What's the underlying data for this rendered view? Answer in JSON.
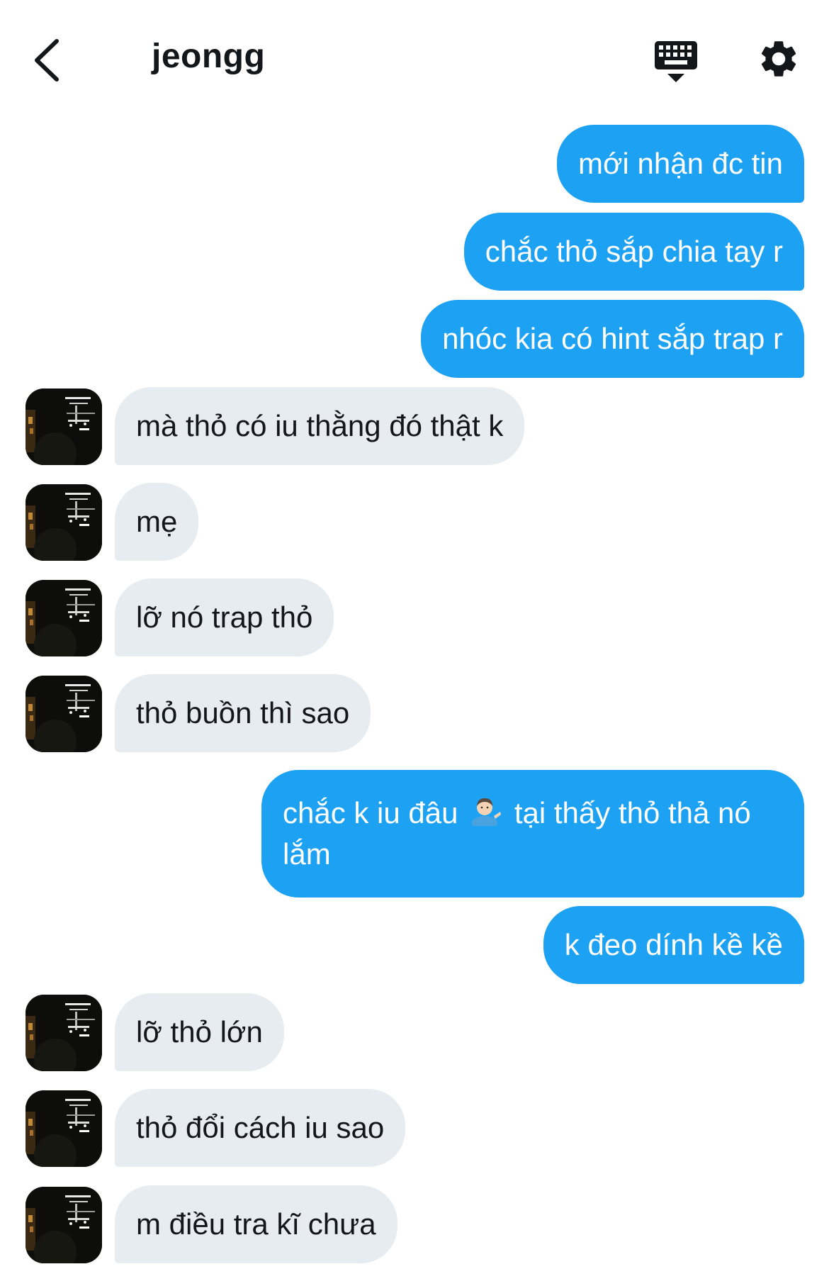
{
  "header": {
    "title": "jeongg",
    "back_icon": "chevron-left-icon",
    "keyboard_icon": "keyboard-dismiss-icon",
    "settings_icon": "gear-icon"
  },
  "colors": {
    "outgoing_bubble": "#1da1f2",
    "incoming_bubble": "#e6ecf0",
    "text_dark": "#14171a"
  },
  "messages": [
    {
      "sender": "me",
      "text": "mới nhận đc tin"
    },
    {
      "sender": "me",
      "text": "chắc thỏ sắp chia tay r"
    },
    {
      "sender": "me",
      "text": "nhóc kia có hint sắp trap r"
    },
    {
      "sender": "jeongg",
      "text": "mà thỏ có iu thằng đó thật k"
    },
    {
      "sender": "jeongg",
      "text": "mẹ"
    },
    {
      "sender": "jeongg",
      "text": "lỡ nó trap thỏ"
    },
    {
      "sender": "jeongg",
      "text": "thỏ buồn thì sao"
    },
    {
      "sender": "me",
      "text_before_emoji": "chắc k iu đâu",
      "emoji": "man-tipping-hand-emoji",
      "text_after_emoji": "tại thấy thỏ thả nó lắm"
    },
    {
      "sender": "me",
      "text": "k đeo dính kề kề"
    },
    {
      "sender": "jeongg",
      "text": "lỡ thỏ lớn"
    },
    {
      "sender": "jeongg",
      "text": "thỏ đổi cách iu sao"
    },
    {
      "sender": "jeongg",
      "text": "m điều tra kĩ chưa"
    }
  ]
}
